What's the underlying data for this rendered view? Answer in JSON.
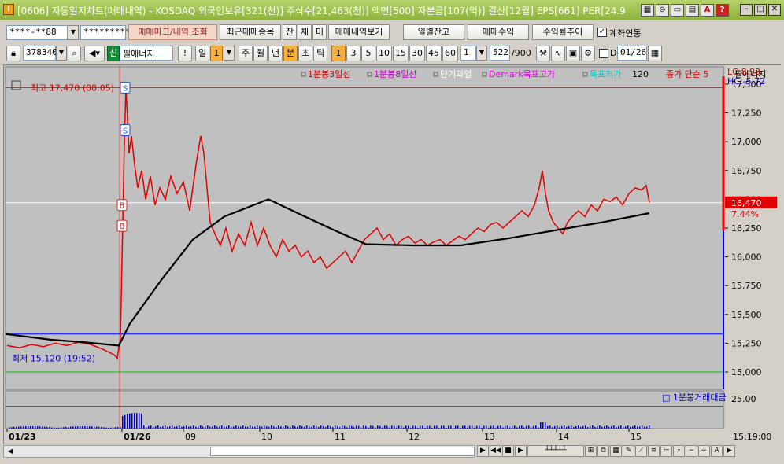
{
  "window": {
    "title": "[0606] 자동일지차트(매매내역) - KOSDAQ 외국인보유[321(천)] 주식수[21,463(천)] 액면[500] 자본금[107(억)] 결산[12월] EPS[661] PER[24.9",
    "app_icon": "I"
  },
  "toolbar1": {
    "account": "****-**88",
    "password": "*********",
    "btn_trade_mark": "매매마크/내역 조회",
    "btn_recent": "최근매매종목",
    "btn_jan": "잔",
    "btn_che": "체",
    "btn_mi": "미",
    "btn_history": "매매내역보기",
    "btn_daily_balance": "일별잔고",
    "btn_profit": "매매수익",
    "btn_return_trend": "수익률추이",
    "account_link_label": "계좌연동",
    "account_link_checked": true
  },
  "toolbar2": {
    "code": "378340",
    "shin": "신",
    "stock_name": "필에너지",
    "exclaim": "!",
    "period_il": "일",
    "period_val": "1",
    "periods": [
      "주",
      "월",
      "년",
      "분",
      "초",
      "틱"
    ],
    "minute_values": [
      "1",
      "3",
      "5",
      "10",
      "15",
      "30",
      "45",
      "60"
    ],
    "unit_value": "1",
    "count_value": "522",
    "count_max": "/900",
    "date_value": "01/26",
    "d_label": "D"
  },
  "legend": [
    {
      "text": "1분봉3일선",
      "color": "#d40000"
    },
    {
      "text": "1분봉8일선",
      "color": "#c000c0"
    },
    {
      "text": "단기과열",
      "color": "#ffffff"
    },
    {
      "text": "Demark목표고가",
      "color": "#e000e0"
    },
    {
      "text": "목표저가",
      "color": "#00c8c8"
    },
    {
      "text": "120",
      "color": "#000000"
    },
    {
      "text": "종가 단순 5",
      "color": "#d40000"
    },
    {
      "text": "필에너지",
      "color": "#000000"
    }
  ],
  "price_axis": {
    "ticks": [
      "17,500",
      "17,250",
      "17,000",
      "16,750",
      "16,500",
      "16,250",
      "16,000",
      "15,750",
      "15,500",
      "15,250",
      "15,000"
    ],
    "lc": "LC:8.93",
    "hc": "HC:-5.72",
    "current_price": "16,470",
    "current_pct": "7.44%"
  },
  "annotations": {
    "high": "최고 17,470 (08:05)",
    "low": "최저 15,120 (19:52)"
  },
  "markers": [
    {
      "label": "S",
      "color": "#2050c0"
    },
    {
      "label": "S",
      "color": "#2050c0"
    },
    {
      "label": "B",
      "color": "#d02020"
    },
    {
      "label": "B",
      "color": "#d02020"
    }
  ],
  "volume": {
    "legend": "1분봉거래대금",
    "axis_value": "25.00"
  },
  "time_axis": {
    "labels": [
      "01/23",
      "01/26",
      "09",
      "10",
      "11",
      "12",
      "13",
      "14",
      "15"
    ],
    "right_label": "15:19:00"
  },
  "chart_data": {
    "type": "line",
    "title": "",
    "series": [
      {
        "name": "1분봉3일선",
        "color": "#d40000"
      },
      {
        "name": "120",
        "color": "#000000"
      }
    ],
    "price_levels": {
      "high": 17470,
      "low": 15120,
      "current": 16470,
      "blue_line": 15330,
      "green_line": 15000,
      "red_line": 17470
    },
    "ylim": [
      14850,
      17650
    ]
  },
  "colors": {
    "price_line": "#e00000",
    "ma_line": "#000000",
    "blue_level": "#0000ff",
    "green_level": "#00c000",
    "red_level": "#ff0000",
    "volume_bar": "#0000c0"
  }
}
